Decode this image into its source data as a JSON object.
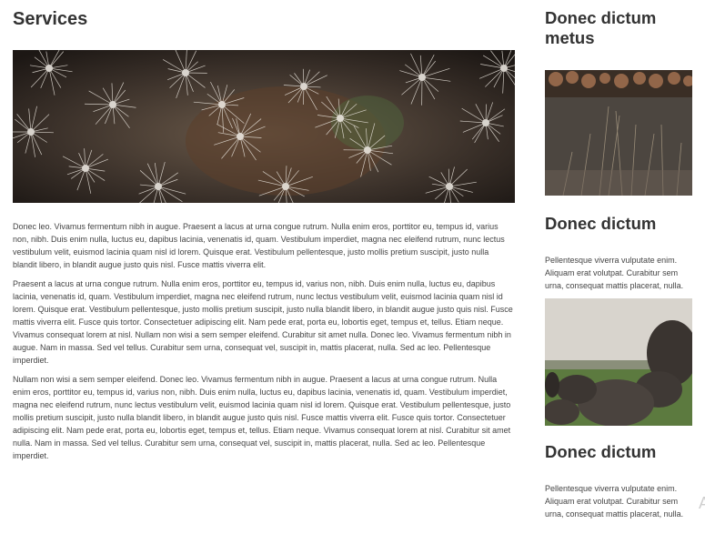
{
  "main": {
    "title": "Services",
    "paragraphs": [
      "Donec leo. Vivamus fermentum nibh in augue. Praesent a lacus at urna congue rutrum. Nulla enim eros, porttitor eu, tempus id, varius non, nibh. Duis enim nulla, luctus eu, dapibus lacinia, venenatis id, quam. Vestibulum imperdiet, magna nec eleifend rutrum, nunc lectus vestibulum velit, euismod lacinia quam nisl id lorem. Quisque erat. Vestibulum pellentesque, justo mollis pretium suscipit, justo nulla blandit libero, in blandit augue justo quis nisl. Fusce mattis viverra elit.",
      "Praesent a lacus at urna congue rutrum. Nulla enim eros, porttitor eu, tempus id, varius non, nibh. Duis enim nulla, luctus eu, dapibus lacinia, venenatis id, quam. Vestibulum imperdiet, magna nec eleifend rutrum, nunc lectus vestibulum velit, euismod lacinia quam nisl id lorem. Quisque erat. Vestibulum pellentesque, justo mollis pretium suscipit, justo nulla blandit libero, in blandit augue justo quis nisl. Fusce mattis viverra elit. Fusce quis tortor. Consectetuer adipiscing elit. Nam pede erat, porta eu, lobortis eget, tempus et, tellus. Etiam neque. Vivamus consequat lorem at nisl. Nullam non wisi a sem semper eleifend. Curabitur sit amet nulla. Donec leo. Vivamus fermentum nibh in augue. Nam in massa. Sed vel tellus. Curabitur sem urna, consequat vel, suscipit in, mattis placerat, nulla. Sed ac leo. Pellentesque imperdiet.",
      "Nullam non wisi a sem semper eleifend. Donec leo. Vivamus fermentum nibh in augue. Praesent a lacus at urna congue rutrum. Nulla enim eros, porttitor eu, tempus id, varius non, nibh. Duis enim nulla, luctus eu, dapibus lacinia, venenatis id, quam. Vestibulum imperdiet, magna nec eleifend rutrum, nunc lectus vestibulum velit, euismod lacinia quam nisl id lorem. Quisque erat. Vestibulum pellentesque, justo mollis pretium suscipit, justo nulla blandit libero, in blandit augue justo quis nisl. Fusce mattis viverra elit. Fusce quis tortor. Consectetuer adipiscing elit. Nam pede erat, porta eu, lobortis eget, tempus et, tellus. Etiam neque. Vivamus consequat lorem at nisl. Curabitur sit amet nulla. Nam in massa. Sed vel tellus. Curabitur sem urna, consequat vel, suscipit in, mattis placerat, nulla. Sed ac leo. Pellentesque imperdiet."
    ]
  },
  "sidebar": {
    "heading_1": "Donec dictum metus",
    "heading_2": "Donec dictum",
    "blurb_2": "Pellentesque viverra vulputate enim. Aliquam erat volutpat. Curabitur sem urna, consequat mattis placerat, nulla.",
    "heading_3": "Donec dictum",
    "blurb_3": "Pellentesque viverra vulputate enim. Aliquam erat volutpat. Curabitur sem urna, consequat mattis placerat, nulla."
  }
}
